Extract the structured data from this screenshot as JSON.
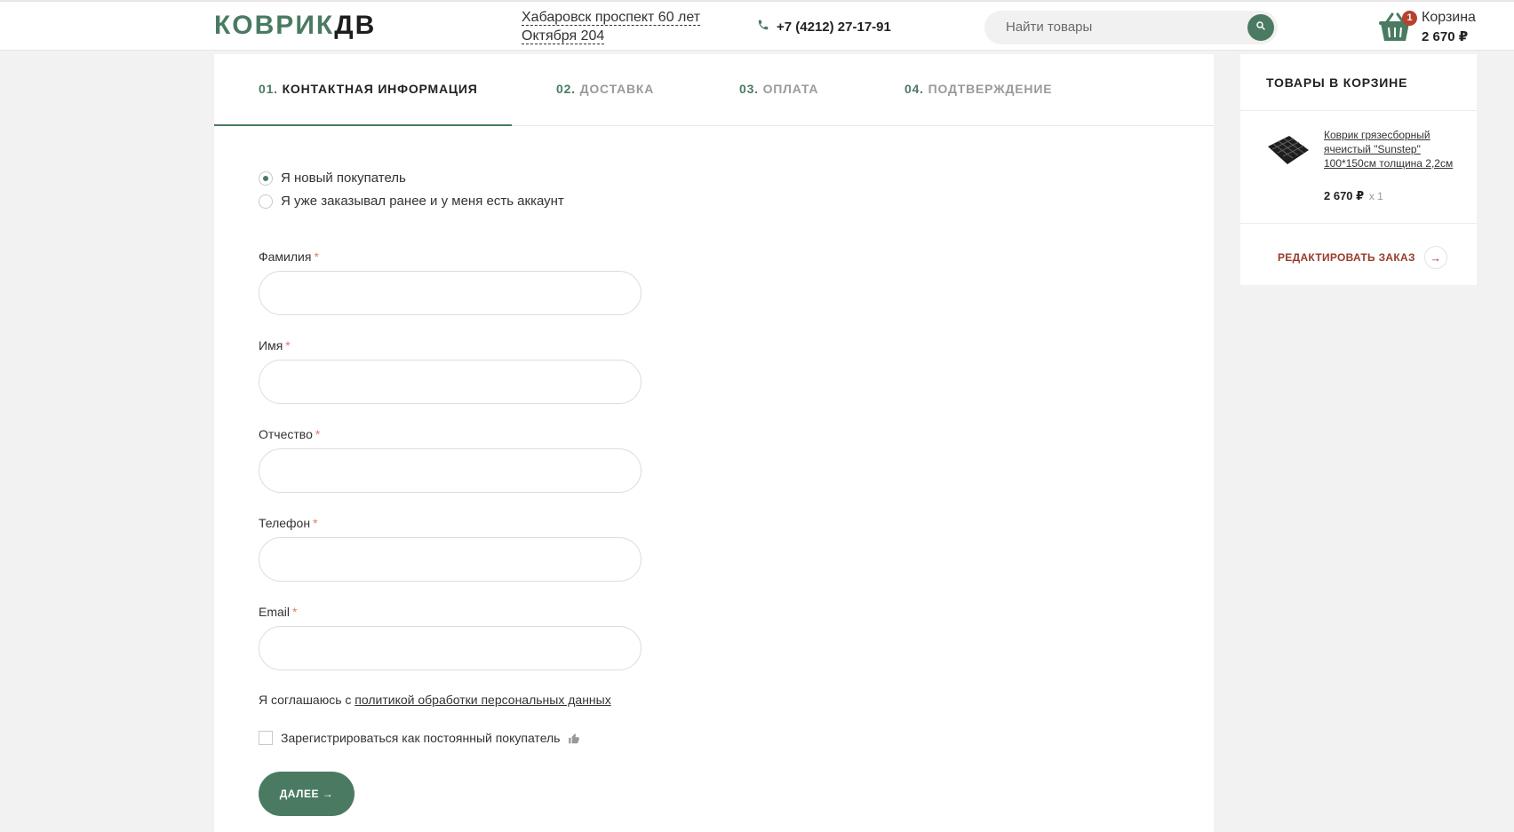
{
  "header": {
    "logo_primary": "КОВРИК",
    "logo_secondary": "ДВ",
    "address": "Хабаровск проспект 60 лет Октября 204",
    "phone": "+7 (4212) 27-17-91",
    "search_placeholder": "Найти товары",
    "cart_count": "1",
    "cart_label": "Корзина",
    "cart_total": "2 670 ₽"
  },
  "steps": [
    {
      "num": "01.",
      "label": "КОНТАКТНАЯ ИНФОРМАЦИЯ"
    },
    {
      "num": "02.",
      "label": "ДОСТАВКА"
    },
    {
      "num": "03.",
      "label": "ОПЛАТА"
    },
    {
      "num": "04.",
      "label": "ПОДТВЕРЖДЕНИЕ"
    }
  ],
  "customer_type": {
    "new": "Я новый покупатель",
    "existing": "Я уже заказывал ранее и у меня есть аккаунт"
  },
  "fields": {
    "last_name": "Фамилия",
    "first_name": "Имя",
    "middle_name": "Отчество",
    "phone": "Телефон",
    "email": "Email",
    "required_mark": "*"
  },
  "agreement": {
    "prefix": "Я соглашаюсь с ",
    "link": "политикой обработки персональных данных"
  },
  "register_label": "Зарегистрироваться как постоянный покупатель",
  "next_button": "ДАЛЕЕ →",
  "sidebar": {
    "title": "ТОВАРЫ В КОРЗИНЕ",
    "product_name": "Коврик грязесборный ячеистый \"Sunstep\" 100*150см толщина 2,2см",
    "product_price": "2 670 ₽",
    "product_qty": "x 1",
    "edit_label": "РЕДАКТИРОВАТЬ ЗАКАЗ",
    "edit_arrow": "→"
  },
  "colors": {
    "accent": "#4a7b62",
    "badge": "#b5432b",
    "edit_link": "#9a3b2a",
    "required": "#e07a6f"
  }
}
